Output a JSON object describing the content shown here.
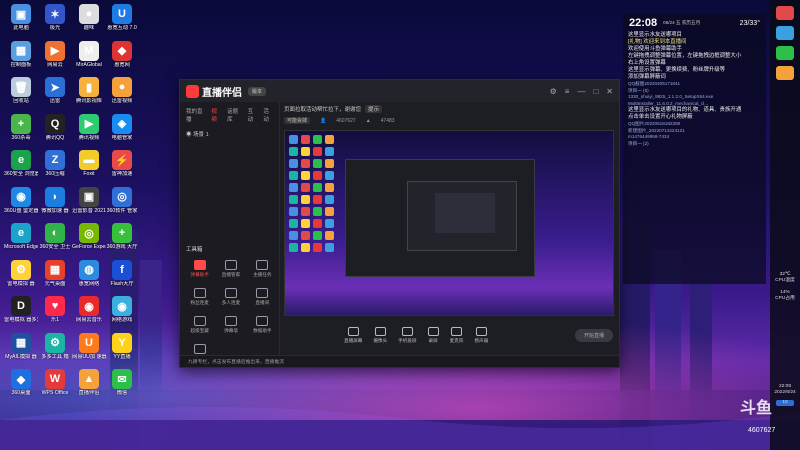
{
  "desktop_icons": [
    {
      "label": "此电脑",
      "color": "#4a90e2",
      "glyph": "▣"
    },
    {
      "label": "极光",
      "color": "#3355cc",
      "glyph": "✶"
    },
    {
      "label": "趣味",
      "color": "#ddd",
      "glyph": "●"
    },
    {
      "label": "惠宽互动\n7.0",
      "color": "#1e7be3",
      "glyph": "U"
    },
    {
      "label": "控制面板",
      "color": "#5aa0e0",
      "glyph": "▦"
    },
    {
      "label": "网易云",
      "color": "#f07030",
      "glyph": "▶"
    },
    {
      "label": "MirAGlobal",
      "color": "#eee",
      "glyph": "M"
    },
    {
      "label": "惠宽网",
      "color": "#d33",
      "glyph": "◆"
    },
    {
      "label": "回收站",
      "color": "#bcd",
      "glyph": "🗑"
    },
    {
      "label": "迅雷",
      "color": "#2a6fd6",
      "glyph": "➤"
    },
    {
      "label": "腾讯影视库",
      "color": "#f5b13a",
      "glyph": "▮"
    },
    {
      "label": "迅雷视频",
      "color": "#f5a03a",
      "glyph": "●"
    },
    {
      "label": "360杀毒",
      "color": "#4ab54a",
      "glyph": "+"
    },
    {
      "label": "腾讯QQ",
      "color": "#222",
      "glyph": "Q"
    },
    {
      "label": "腾讯视频",
      "color": "#2ecc71",
      "glyph": "▶"
    },
    {
      "label": "电脑管家",
      "color": "#1a8bf0",
      "glyph": "◈"
    },
    {
      "label": "360安全\n浏览器",
      "color": "#1aa34a",
      "glyph": "e"
    },
    {
      "label": "360压缩",
      "color": "#2f6fd6",
      "glyph": "Z"
    },
    {
      "label": "Foxit",
      "color": "#f2cd2a",
      "glyph": "▬"
    },
    {
      "label": "雷神加速",
      "color": "#e84a4a",
      "glyph": "⚡"
    },
    {
      "label": "360U盘\n鉴定器",
      "color": "#1e88e5",
      "glyph": "◉"
    },
    {
      "label": "微微加速\n器",
      "color": "#1a7de0",
      "glyph": "◗"
    },
    {
      "label": "迅雷影音\n2021",
      "color": "#444",
      "glyph": "▣"
    },
    {
      "label": "360软件\n管家",
      "color": "#2f6fd6",
      "glyph": "◎"
    },
    {
      "label": "Microsoft\nEdge",
      "color": "#1ca3c9",
      "glyph": "e"
    },
    {
      "label": "360安全\n卫士",
      "color": "#32b34a",
      "glyph": "◐"
    },
    {
      "label": "GeForce\nExperience",
      "color": "#76b900",
      "glyph": "◎"
    },
    {
      "label": "360游戏\n大厅",
      "color": "#37c03a",
      "glyph": "+"
    },
    {
      "label": "雷电模拟\n器",
      "color": "#ffd23a",
      "glyph": "⚙"
    },
    {
      "label": "元气桌面",
      "color": "#e8412a",
      "glyph": "▦"
    },
    {
      "label": "惠宽网络",
      "color": "#2b8be0",
      "glyph": "◍"
    },
    {
      "label": "Flash大厅",
      "color": "#1a4fd6",
      "glyph": "f"
    },
    {
      "label": "雷电模拟\n器多开",
      "color": "#222",
      "glyph": "D"
    },
    {
      "label": "乐1",
      "color": "#ff2a4a",
      "glyph": "♥"
    },
    {
      "label": "网易云音乐",
      "color": "#e82a2a",
      "glyph": "◉"
    },
    {
      "label": "网络游戏",
      "color": "#3ab0e0",
      "glyph": "◉"
    },
    {
      "label": "MyAIL模拟\n器",
      "color": "#2250a0",
      "glyph": "▦"
    },
    {
      "label": "多多工具\n箱",
      "color": "#1ab5a5",
      "glyph": "⚙"
    },
    {
      "label": "网易UU加\n速器",
      "color": "#ff7a1a",
      "glyph": "U"
    },
    {
      "label": "YY直播",
      "color": "#ffd21a",
      "glyph": "Y"
    },
    {
      "label": "360桌面",
      "color": "#1e6fe0",
      "glyph": "◆"
    },
    {
      "label": "WPS\nOffice",
      "color": "#e63a3a",
      "glyph": "W"
    },
    {
      "label": "直播伴侣",
      "color": "#f5a23a",
      "glyph": "▲"
    },
    {
      "label": "微信",
      "color": "#2cc04a",
      "glyph": "✉"
    }
  ],
  "window": {
    "app_title": "直播伴侣",
    "version_badge": "版本",
    "left_tabs": [
      "我的直播",
      "视频",
      "话题库",
      "互动",
      "活动"
    ],
    "scene_label": "场景 1",
    "tools_heading": "工具箱",
    "tools": [
      {
        "label": "弹幕助手",
        "active": true
      },
      {
        "label": "直播管家",
        "active": false
      },
      {
        "label": "主播任务",
        "active": false
      },
      {
        "label": "粉丝连麦",
        "active": false
      },
      {
        "label": "多人连麦",
        "active": false
      },
      {
        "label": "直播间",
        "active": false
      },
      {
        "label": "超级宝藏",
        "active": false
      },
      {
        "label": "弹幕墙",
        "active": false
      },
      {
        "label": "数据助手",
        "active": false
      },
      {
        "label": "小道助手",
        "active": false
      }
    ],
    "notice_text": "页面拉取活动帮忙拉下，谢谢您",
    "notice_key": "提示",
    "stats_pill": "可能会掉",
    "stats_views": "4607627",
    "stats_likes": "47483",
    "bottom_buttons": [
      "直播屏幕",
      "摄像头",
      "手机投屏",
      "录屏",
      "麦克风",
      "扬声器"
    ],
    "start_live": "开始直播",
    "status_text": "九耕专栏，点击发布直播后推出来，直播推流"
  },
  "chat": {
    "time": "22:08",
    "date": "06/24 五 农历五月",
    "temp": "23/33°",
    "header": "这里显示水友送哪项目",
    "messages": [
      {
        "text": "[礼物] 欢迎来到本直播间",
        "style": "y"
      },
      {
        "text": "欢迎使用斗鱼弹幕助手",
        "style": ""
      },
      {
        "text": "左键拖拽调整弹幕位置，左键拖拽边框调整大小",
        "style": ""
      },
      {
        "text": "右上角设置弹幕",
        "style": ""
      },
      {
        "text": "这里显示弹幕、更换续费、粉丝牌升级等",
        "style": ""
      },
      {
        "text": "添加弹幕屏蔽词",
        "style": ""
      },
      {
        "text": "QQ截图20220405171841",
        "style": "sm"
      },
      {
        "text": "项目一 (5)",
        "style": "sm"
      },
      {
        "text": "1330_shuiyi_9825_1.1.2.0_SetupX64.exe",
        "style": "sm"
      },
      {
        "text": "MultiInstaller_11.6.0.2_mechanical_cl...",
        "style": "sm"
      },
      {
        "text": "这里显示水友送哪项目的礼物、道具、贵族开通",
        "style": ""
      },
      {
        "text": "点击单击设置开心礼物屏蔽",
        "style": ""
      },
      {
        "text": "QQ图片20220518182308",
        "style": "sm"
      },
      {
        "text": "新建图片_20220714224121",
        "style": "sm"
      },
      {
        "text": "m1476449958-7434",
        "style": "sm"
      },
      {
        "text": "项目一 (2)",
        "style": "sm"
      }
    ]
  },
  "taskbar": {
    "cpu_temp": "32℃",
    "cpu_temp_label": "CPU温度",
    "cpu_use": "14%",
    "cpu_use_label": "CPU占用",
    "clock": "22:08",
    "date": "2022/6/24",
    "badge": "10"
  },
  "watermark": {
    "brand": "斗鱼",
    "room": "4607627"
  }
}
